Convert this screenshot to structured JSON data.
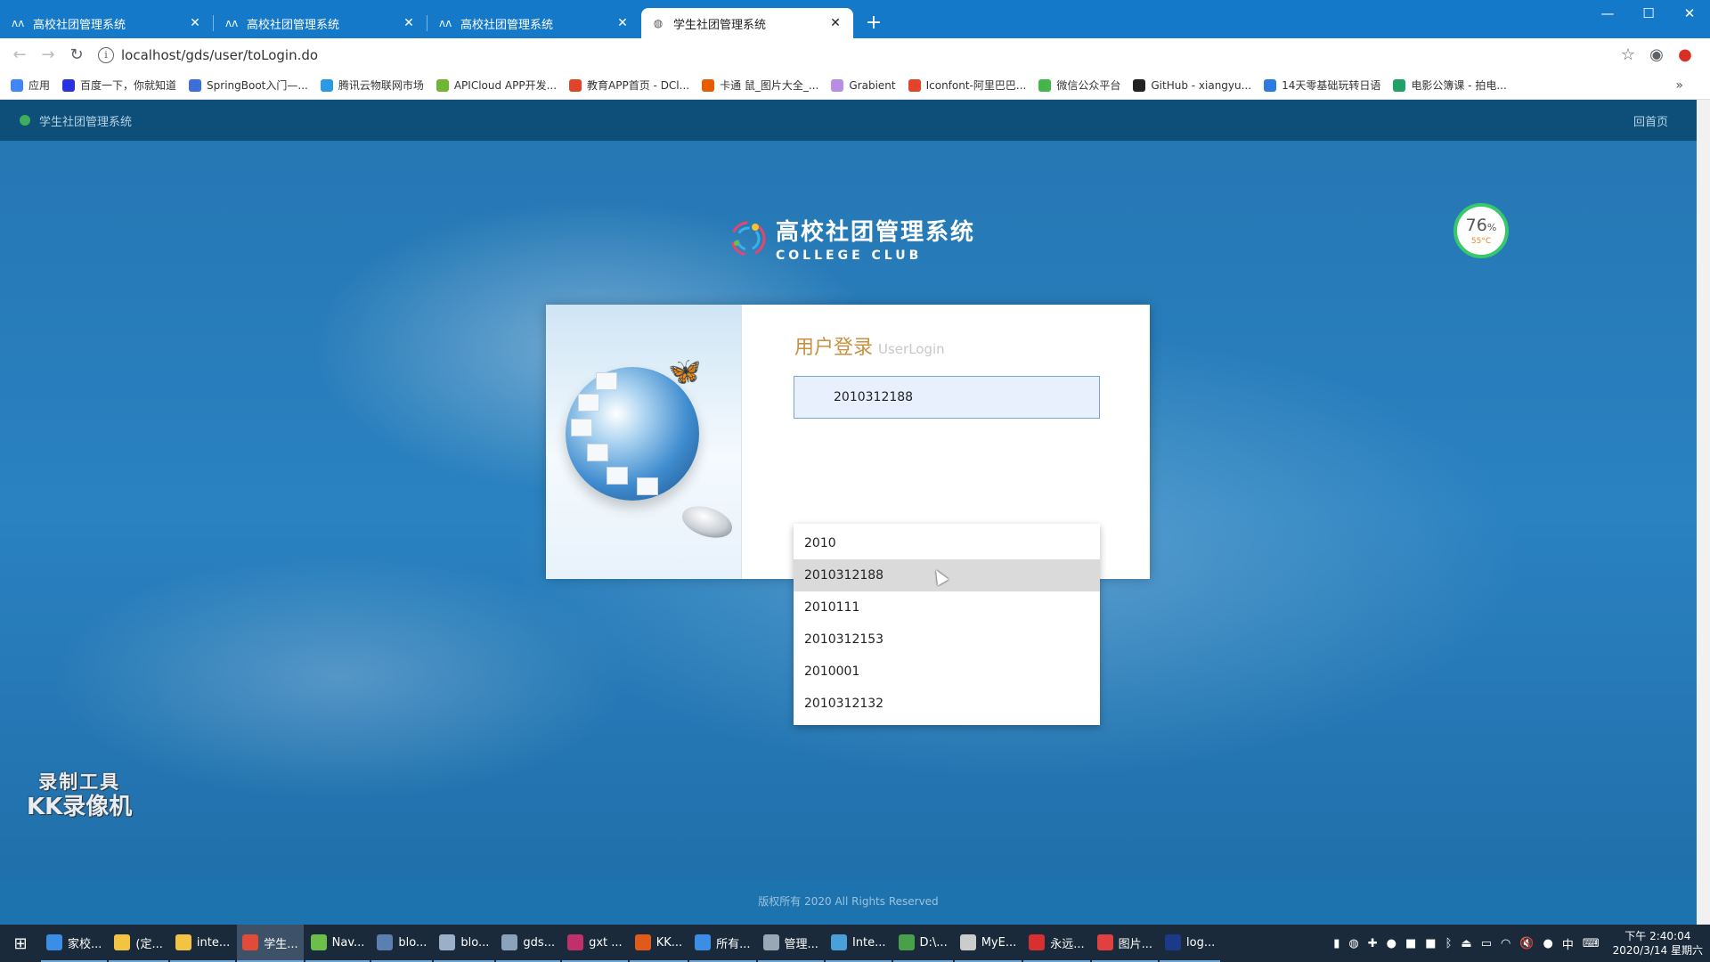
{
  "browser": {
    "tabs": [
      {
        "title": "高校社团管理系统",
        "active": false
      },
      {
        "title": "高校社团管理系统",
        "active": false
      },
      {
        "title": "高校社团管理系统",
        "active": false
      },
      {
        "title": "学生社团管理系统",
        "active": true
      }
    ],
    "new_tab_label": "+",
    "url": "localhost/gds/user/toLogin.do",
    "bookmarks": [
      {
        "label": "应用",
        "icon": "apps-icon",
        "color": "#4285f4"
      },
      {
        "label": "百度一下，你就知道",
        "icon": "baidu-icon",
        "color": "#2932e1"
      },
      {
        "label": "SpringBoot入门—...",
        "icon": "pen-icon",
        "color": "#3d6fd8"
      },
      {
        "label": "腾讯云物联网市场",
        "icon": "cloud-icon",
        "color": "#2a9be0"
      },
      {
        "label": "APICloud APP开发...",
        "icon": "apicloud-icon",
        "color": "#6fb536"
      },
      {
        "label": "教育APP首页 - DCl...",
        "icon": "d-icon",
        "color": "#e0452a"
      },
      {
        "label": "卡通 鼠_图片大全_...",
        "icon": "a-icon",
        "color": "#e65c00"
      },
      {
        "label": "Grabient",
        "icon": "gradient-icon",
        "color": "#b98ce6"
      },
      {
        "label": "Iconfont-阿里巴巴...",
        "icon": "iconfont-icon",
        "color": "#e2452b"
      },
      {
        "label": "微信公众平台",
        "icon": "wechat-icon",
        "color": "#44b549"
      },
      {
        "label": "GitHub - xiangyu...",
        "icon": "github-icon",
        "color": "#222222"
      },
      {
        "label": "14天零基础玩转日语",
        "icon": "book-icon",
        "color": "#2d7be0"
      },
      {
        "label": "电影公簿课 - 拍电...",
        "icon": "e-icon",
        "color": "#21a366"
      }
    ]
  },
  "page": {
    "system_name": "学生社团管理系统",
    "home_link": "回首页",
    "logo_title": "高校社团管理系统",
    "logo_subtitle": "COLLEGE CLUB",
    "login_title_zh": "用户登录",
    "login_title_en": "UserLogin",
    "username_value": "2010312188",
    "suggestions": [
      "2010",
      "2010312188",
      "2010111",
      "2010312153",
      "2010001",
      "2010312132"
    ],
    "hovered_suggestion_index": 1,
    "footer_text": "版权所有 2020 All Rights Reserved",
    "watermark_line1": "录制工具",
    "watermark_line2": "KK录像机"
  },
  "gauge": {
    "percent": "76",
    "percent_unit": "%",
    "temp": "55°C"
  },
  "taskbar": {
    "items": [
      {
        "label": "家校...",
        "color": "#3a8ee6"
      },
      {
        "label": "(定...",
        "color": "#f3c443"
      },
      {
        "label": "inte...",
        "color": "#f3c443"
      },
      {
        "label": "学生...",
        "color": "#e04b3a",
        "active": true
      },
      {
        "label": "Nav...",
        "color": "#6cc04a"
      },
      {
        "label": "blo...",
        "color": "#5a7fb0"
      },
      {
        "label": "blo...",
        "color": "#9ab0c8"
      },
      {
        "label": "gds...",
        "color": "#8aa2bc"
      },
      {
        "label": "gxt ...",
        "color": "#c0306a"
      },
      {
        "label": "KK...",
        "color": "#e05a1a"
      },
      {
        "label": "所有...",
        "color": "#3a8ee6"
      },
      {
        "label": "管理...",
        "color": "#9aa8b6"
      },
      {
        "label": "Inte...",
        "color": "#4aa0d8"
      },
      {
        "label": "D:\\...",
        "color": "#4aa04a"
      },
      {
        "label": "MyE...",
        "color": "#cccccc"
      },
      {
        "label": "永远...",
        "color": "#d83030"
      },
      {
        "label": "图片...",
        "color": "#e04040"
      },
      {
        "label": "log...",
        "color": "#1c3a8a"
      }
    ],
    "ime": "中",
    "time": "下午 2:40:04",
    "date": "2020/3/14 星期六"
  }
}
